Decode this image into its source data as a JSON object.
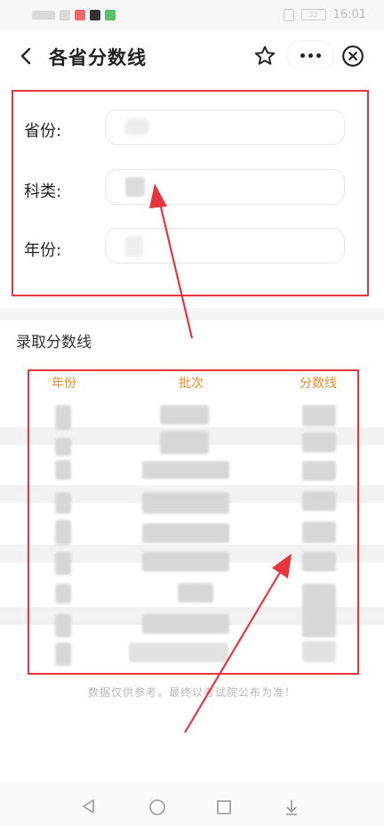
{
  "status_bar": {
    "time": "16:01",
    "battery": "33"
  },
  "navbar": {
    "title": "各省分数线"
  },
  "form": {
    "province_label": "省份:",
    "subject_label": "科类:",
    "year_label": "年份:"
  },
  "section": {
    "title": "录取分数线"
  },
  "table": {
    "headers": [
      "年份",
      "批次",
      "分数线"
    ]
  },
  "footnote": "数据仅供参考，最终以考试院公布为准！",
  "colors": {
    "annotation_red": "#e6353d",
    "header_orange": "#f08b2a"
  }
}
